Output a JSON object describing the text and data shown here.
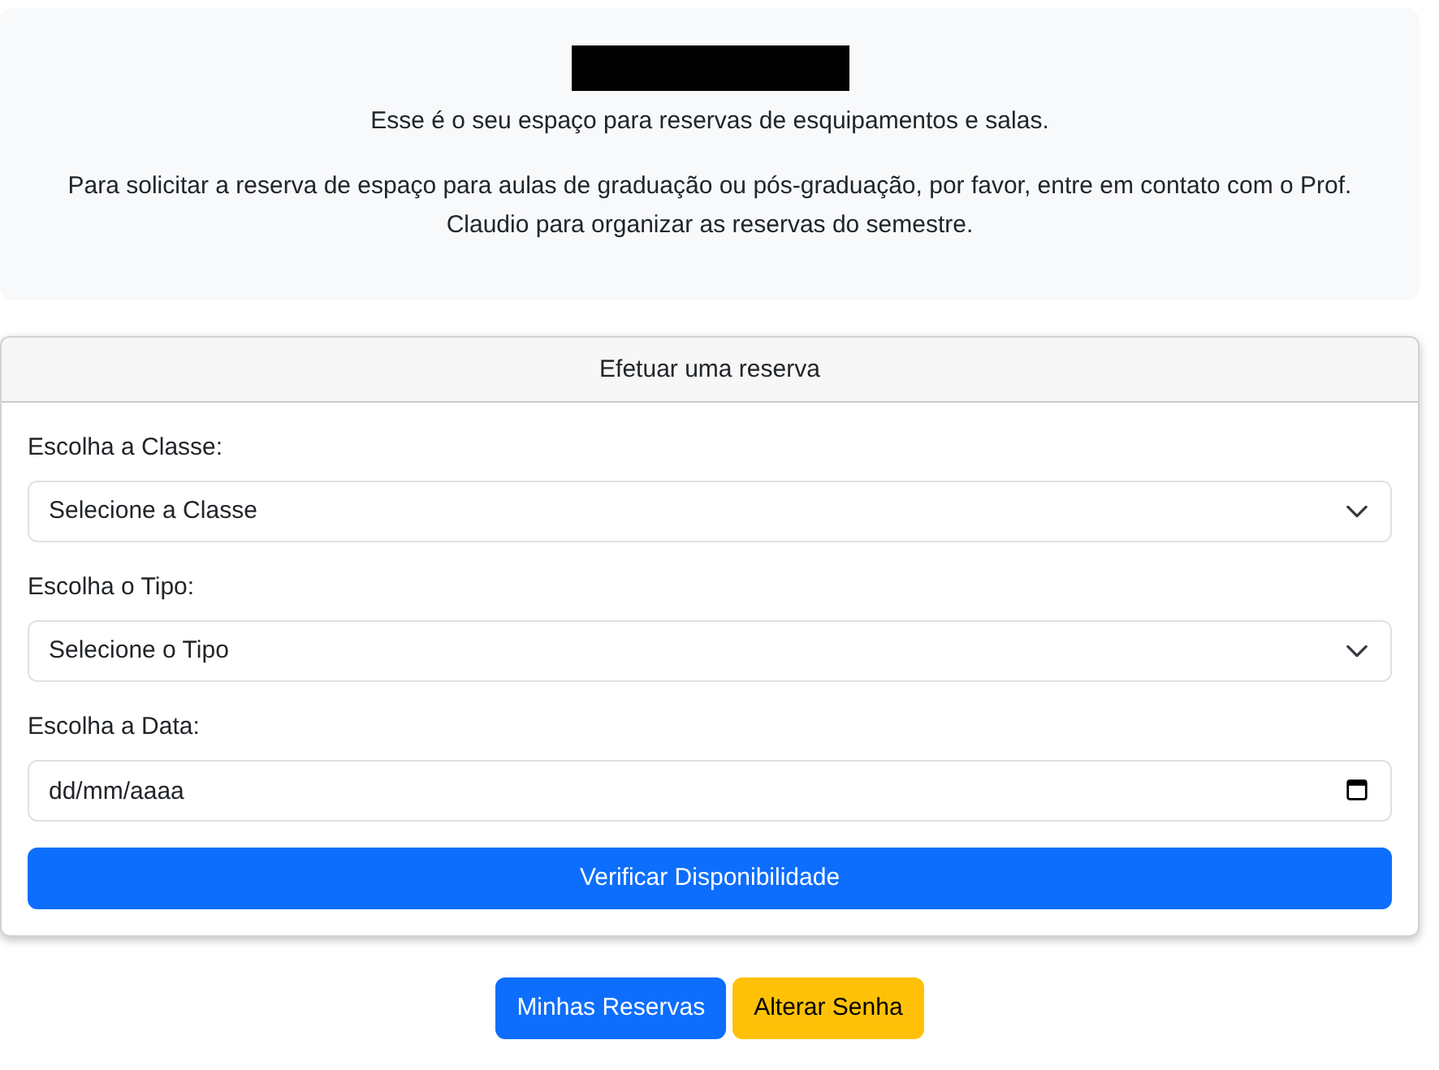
{
  "header": {
    "intro": "Esse é o seu espaço para reservas de esquipamentos e salas.",
    "notice": "Para solicitar a reserva de espaço para aulas de graduação ou pós-graduação, por favor, entre em contato com o Prof. Claudio para organizar as reservas do semestre."
  },
  "reservation_card": {
    "title": "Efetuar uma reserva",
    "fields": [
      {
        "kind": "select",
        "label": "Escolha a Classe:",
        "value": "Selecione a Classe"
      },
      {
        "kind": "select",
        "label": "Escolha o Tipo:",
        "value": "Selecione o Tipo"
      },
      {
        "kind": "date",
        "label": "Escolha a Data:",
        "placeholder": "dd/mm/aaaa"
      }
    ],
    "submit": "Verificar Disponibilidade"
  },
  "actions": [
    {
      "kind": "primary",
      "label": "Minhas Reservas"
    },
    {
      "kind": "warning",
      "label": "Alterar Senha"
    }
  ]
}
